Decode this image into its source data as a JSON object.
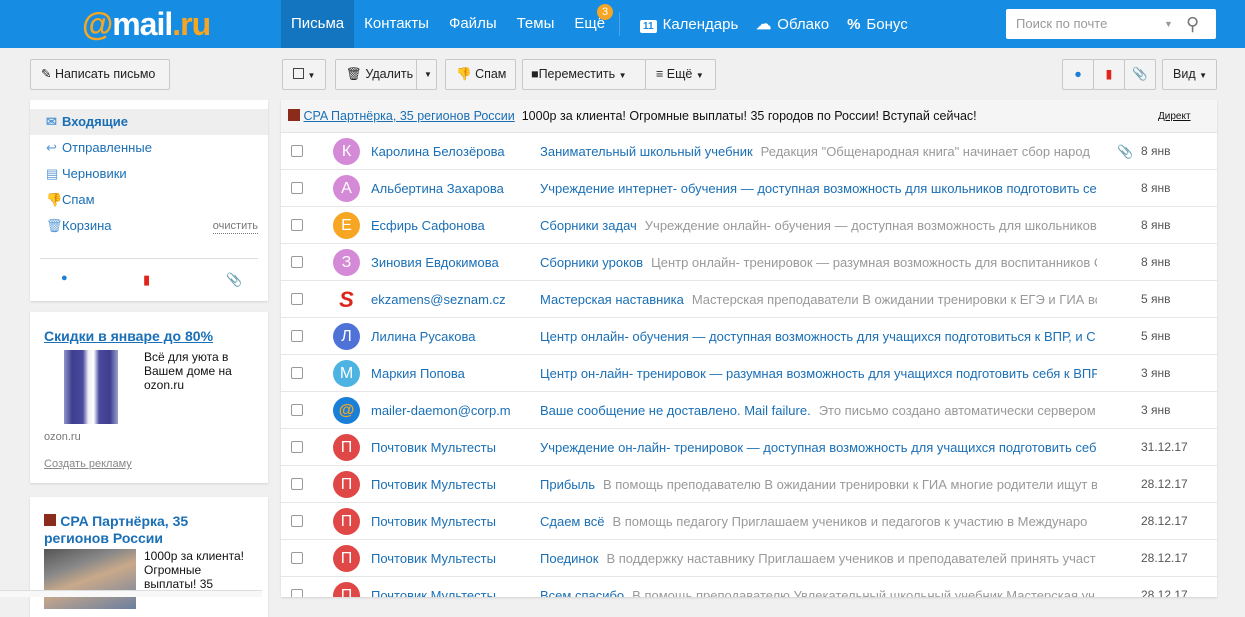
{
  "header": {
    "logo_prefix": "@",
    "logo_main": "mail",
    "logo_suffix": ".ru",
    "nav": [
      "Письма",
      "Контакты",
      "Файлы",
      "Темы",
      "Ещё"
    ],
    "more_badge": "3",
    "calendar": "Календарь",
    "calendar_day": "11",
    "cloud": "Облако",
    "bonus": "Бонус",
    "search_placeholder": "Поиск по почте"
  },
  "toolbar": {
    "compose": "Написать письмо",
    "delete": "Удалить",
    "spam": "Спам",
    "move": "Переместить",
    "more": "Ещё",
    "view": "Вид"
  },
  "folders": [
    {
      "label": "Входящие",
      "icon": "envelope-icon"
    },
    {
      "label": "Отправленные",
      "icon": "reply-icon"
    },
    {
      "label": "Черновики",
      "icon": "draft-icon"
    },
    {
      "label": "Спам",
      "icon": "thumbs-down-icon"
    },
    {
      "label": "Корзина",
      "icon": "trash-icon"
    }
  ],
  "clear_label": "очистить",
  "ad1": {
    "title": "Скидки в январе до 80%",
    "text": "Всё для уюта в Вашем доме на ozon.ru",
    "domain": "ozon.ru",
    "create": "Создать рекламу"
  },
  "ad2": {
    "title": "CPA Партнёрка, 35 регионов России",
    "text": "1000р за клиента! Огромные выплаты! 35"
  },
  "adrow": {
    "link": "CPA Партнёрка, 35 регионов России",
    "text": "1000р за клиента! Огромные выплаты! 35 городов по России! Вступай сейчас!",
    "label": "Директ"
  },
  "colors": {
    "header": "#168de2",
    "link": "#1a6fb5",
    "accent": "#f6a623"
  },
  "messages": [
    {
      "letter": "К",
      "color": "#d58ad8",
      "sender": "Каролина Белозёрова",
      "subject": "Занимательный школьный учебник",
      "preview": "Редакция \"Общенародная книга\" начинает сбор народ",
      "attach": true,
      "date": "8 янв"
    },
    {
      "letter": "А",
      "color": "#d58ad8",
      "sender": "Альбертина Захарова",
      "subject": "Учреждение интернет- обучения — доступная возможность для школьников подготовить се",
      "preview": "",
      "attach": false,
      "date": "8 янв"
    },
    {
      "letter": "Е",
      "color": "#f6a623",
      "sender": "Есфирь Сафонова",
      "subject": "Сборники задач",
      "preview": "Учреждение онлайн- обучения — доступная возможность для школьников",
      "attach": false,
      "date": "8 янв"
    },
    {
      "letter": "З",
      "color": "#d58ad8",
      "sender": "Зиновия Евдокимова",
      "subject": "Сборники уроков",
      "preview": "Центр онлайн- тренировок — разумная возможность для воспитанников С",
      "attach": false,
      "date": "8 янв"
    },
    {
      "letter": "S",
      "color": "#ffffff",
      "sender": "ekzamens@seznam.cz",
      "subject": "Мастерская наставника",
      "preview": "Мастерская преподаватели В ожидании тренировки к ЕГЭ и ГИА во",
      "attach": false,
      "date": "5 янв"
    },
    {
      "letter": "Л",
      "color": "#4f72d6",
      "sender": "Лилина Русакова",
      "subject": "Центр онлайн- обучения — доступная возможность для учащихся подготовиться к ВПР, и С",
      "preview": "",
      "attach": false,
      "date": "5 янв"
    },
    {
      "letter": "М",
      "color": "#4db3e2",
      "sender": "Маркия Попова",
      "subject": "Центр он-лайн- тренировок — разумная возможность для учащихся подготовить себя к ВПР",
      "preview": "",
      "attach": false,
      "date": "3 янв"
    },
    {
      "letter": "@",
      "color": "#1a7fd6",
      "sender": "mailer-daemon@corp.m",
      "subject": "Ваше сообщение не доставлено. Mail failure.",
      "preview": "Это письмо создано автоматически сервером",
      "attach": false,
      "date": "3 янв"
    },
    {
      "letter": "П",
      "color": "#e04848",
      "sender": "Почтовик Мультесты",
      "subject": "Учреждение он-лайн- тренировок — доступная возможность для учащихся подготовить себ",
      "preview": "",
      "attach": false,
      "date": "31.12.17"
    },
    {
      "letter": "П",
      "color": "#e04848",
      "sender": "Почтовик Мультесты",
      "subject": "Прибыль",
      "preview": "В помощь преподавателю В ожидании тренировки к ГИА многие родители ищут в",
      "attach": false,
      "date": "28.12.17"
    },
    {
      "letter": "П",
      "color": "#e04848",
      "sender": "Почтовик Мультесты",
      "subject": "Сдаем всё",
      "preview": "В помощь педагогу Приглашаем учеников и педагогов к участию в Междунаро",
      "attach": false,
      "date": "28.12.17"
    },
    {
      "letter": "П",
      "color": "#e04848",
      "sender": "Почтовик Мультесты",
      "subject": "Поединок",
      "preview": "В поддержку наставнику Приглашаем учеников и преподавателей принять участ",
      "attach": false,
      "date": "28.12.17"
    },
    {
      "letter": "П",
      "color": "#e04848",
      "sender": "Почтовик Мультесты",
      "subject": "Всем спасибо",
      "preview": "В помощь преподавателю Увлекательный школьный учебник Мастерская уч",
      "attach": false,
      "date": "28.12.17"
    }
  ]
}
